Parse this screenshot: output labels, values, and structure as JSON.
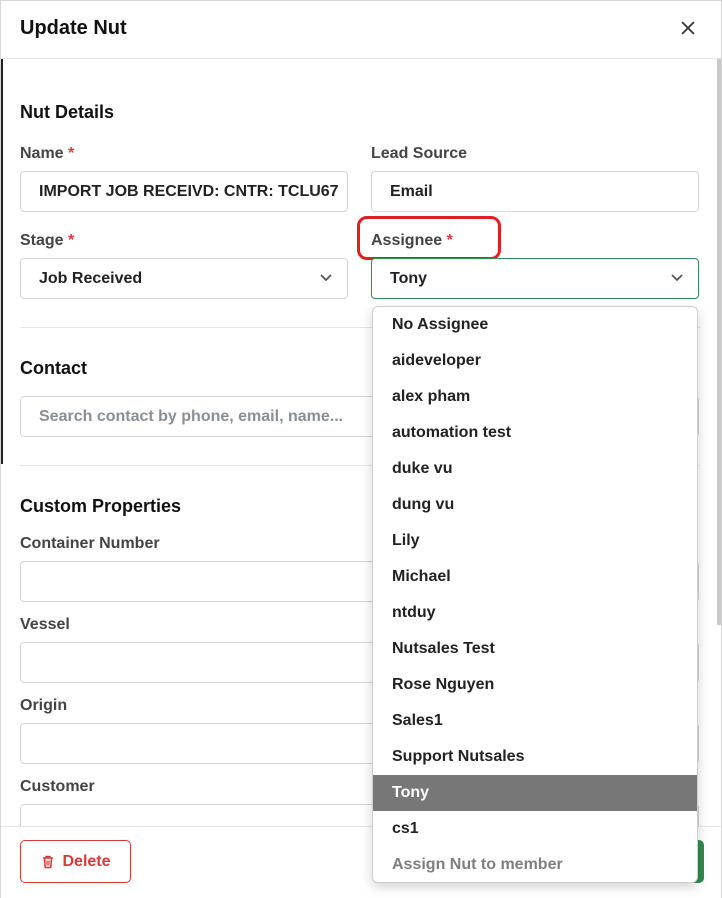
{
  "modal": {
    "title": "Update Nut"
  },
  "nut_details": {
    "section_title": "Nut Details",
    "name_label": "Name",
    "name_value": "IMPORT JOB RECEIVD: CNTR: TCLU67",
    "lead_source_label": "Lead Source",
    "lead_source_value": "Email",
    "stage_label": "Stage",
    "stage_value": "Job Received",
    "assignee_label": "Assignee",
    "assignee_value": "Tony",
    "required_mark": "*"
  },
  "contact": {
    "section_title": "Contact",
    "search_placeholder": "Search contact by phone, email, name..."
  },
  "custom_properties": {
    "section_title": "Custom Properties",
    "container_number_label": "Container Number",
    "vessel_label": "Vessel",
    "origin_label": "Origin",
    "customer_label": "Customer"
  },
  "footer": {
    "delete_label": "Delete"
  },
  "assignee_dropdown": {
    "options": [
      "No Assignee",
      "aideveloper",
      "alex pham",
      "automation test",
      "duke vu",
      "dung vu",
      "Lily",
      "Michael",
      "ntduy",
      "Nutsales Test",
      "Rose Nguyen",
      "Sales1",
      "Support Nutsales",
      "Tony",
      "cs1"
    ],
    "selected": "Tony",
    "hint": "Assign Nut to member"
  },
  "colors": {
    "accent_green": "#2f8d4e",
    "danger_red": "#d93939",
    "annotation_red": "#e02020",
    "selected_option_bg": "#777777"
  },
  "icons": {
    "close": "close-icon",
    "chevron": "chevron-down-icon",
    "trash": "trash-icon"
  }
}
